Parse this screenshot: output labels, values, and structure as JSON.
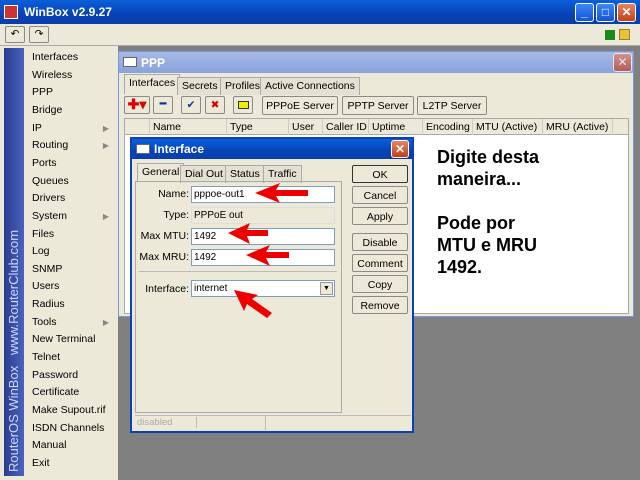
{
  "app": {
    "title": "WinBox v2.9.27",
    "sidebar_brand": "RouterOS WinBox",
    "sidebar_url": "www.RouterClub.com"
  },
  "menu": [
    "Interfaces",
    "Wireless",
    "PPP",
    "Bridge",
    "IP",
    "Routing",
    "Ports",
    "Queues",
    "Drivers",
    "System",
    "Files",
    "Log",
    "SNMP",
    "Users",
    "Radius",
    "Tools",
    "New Terminal",
    "Telnet",
    "Password",
    "Certificate",
    "Make Supout.rif",
    "ISDN Channels",
    "Manual",
    "Exit"
  ],
  "menu_submenu": [
    "IP",
    "Routing",
    "System",
    "Tools"
  ],
  "ppp": {
    "title": "PPP",
    "tabs": [
      "Interfaces",
      "Secrets",
      "Profiles",
      "Active Connections"
    ],
    "buttons": [
      "PPPoE Server",
      "PPTP Server",
      "L2TP Server"
    ],
    "columns": [
      "Name",
      "Type",
      "User",
      "Caller ID",
      "Uptime",
      "Encoding",
      "MTU (Active)",
      "MRU (Active)"
    ]
  },
  "dialog": {
    "title": "Interface",
    "tabs": [
      "General",
      "Dial Out",
      "Status",
      "Traffic"
    ],
    "name_label": "Name:",
    "name_value": "pppoe-out1",
    "type_label": "Type:",
    "type_value": "PPPoE out",
    "mtu_label": "Max MTU:",
    "mtu_value": "1492",
    "mru_label": "Max MRU:",
    "mru_value": "1492",
    "iface_label": "Interface:",
    "iface_value": "internet",
    "buttons": [
      "OK",
      "Cancel",
      "Apply",
      "Disable",
      "Comment",
      "Copy",
      "Remove"
    ],
    "status": "disabled"
  },
  "annotation": {
    "line1": "Digite desta",
    "line2": "maneira...",
    "line3": "Pode por",
    "line4": "MTU e MRU",
    "line5": "1492."
  }
}
